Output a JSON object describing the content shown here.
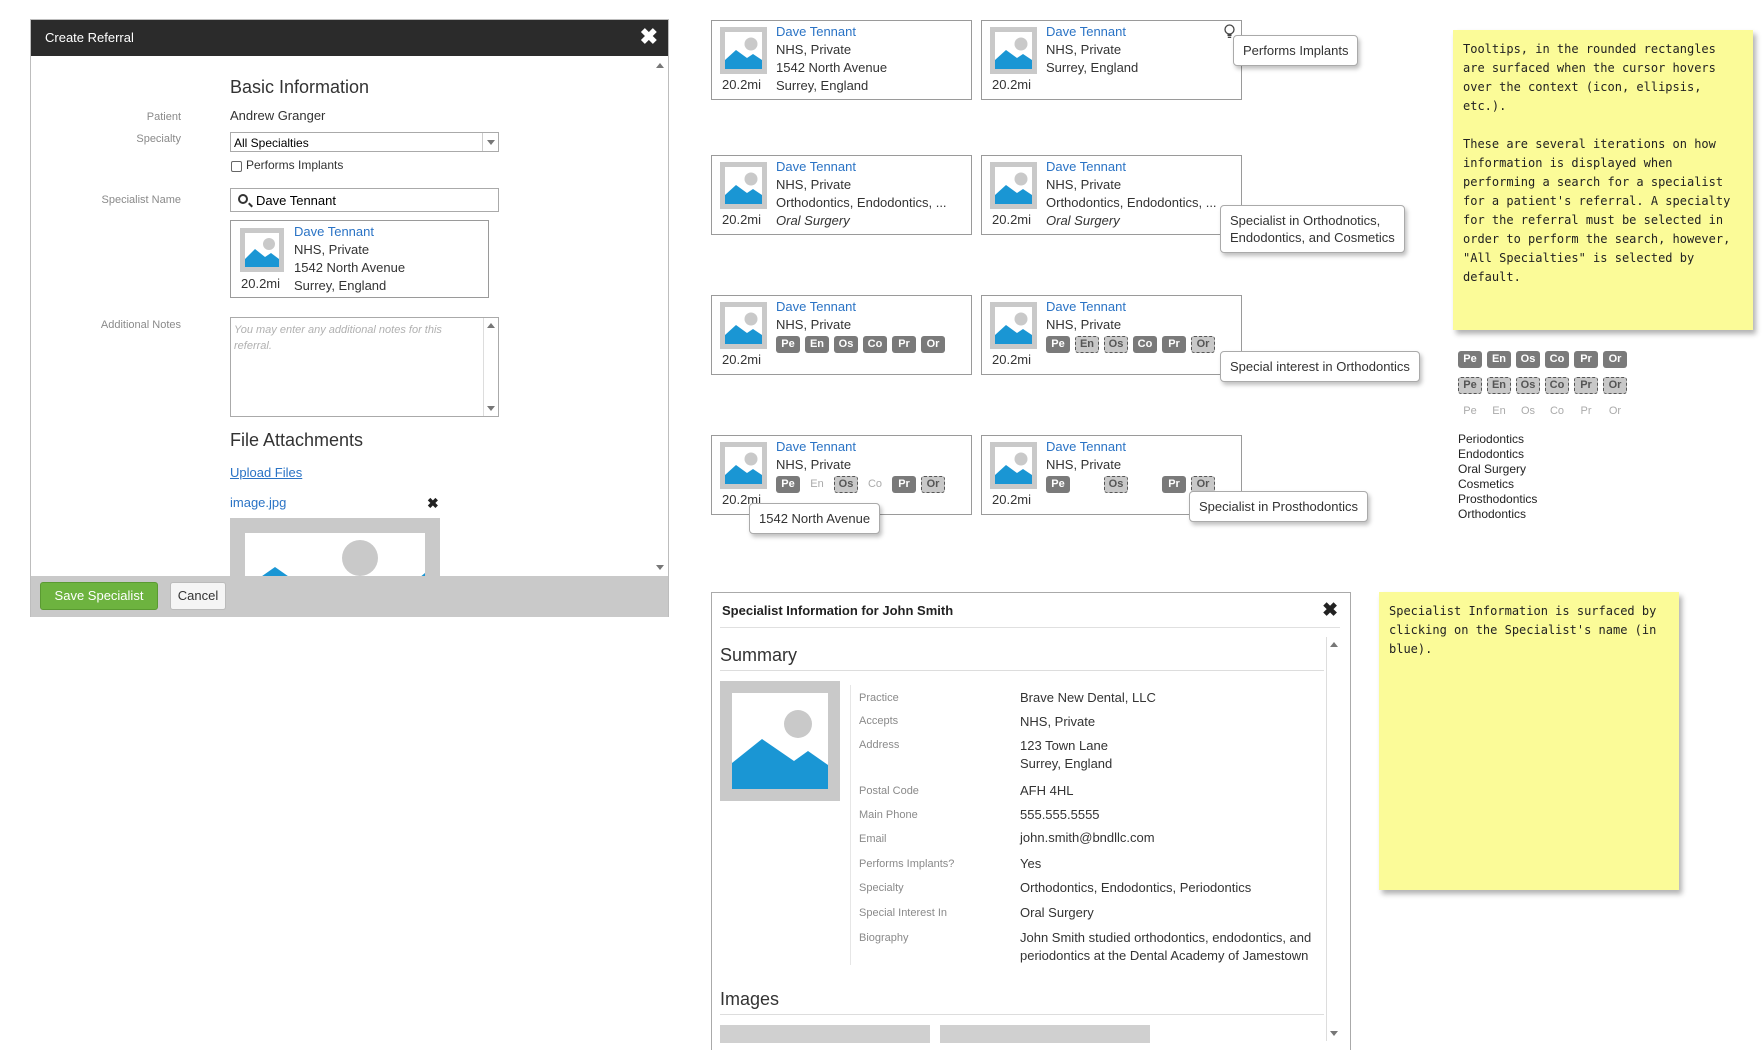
{
  "colors": {
    "link": "#2a73c5",
    "titlebar": "#2b2b2b",
    "save_button": "#6db33f",
    "sticky": "#fbfb98",
    "badge": "#7a7a7a",
    "image_blue": "#1a96d4"
  },
  "referral": {
    "title": "Create Referral",
    "close_icon": "close-icon",
    "section_basic": "Basic Information",
    "patient_label": "Patient",
    "patient_value": "Andrew Granger",
    "specialty_label": "Specialty",
    "specialty_value": "All Specialties",
    "performs_implants_label": "Performs Implants",
    "specialist_name_label": "Specialist Name",
    "specialist_search_value": "Dave Tennant",
    "result": {
      "distance": "20.2mi",
      "name": "Dave Tennant",
      "accepts": "NHS, Private",
      "address1": "1542 North Avenue",
      "address2": "Surrey, England"
    },
    "notes_label": "Additional Notes",
    "notes_placeholder": "You may enter any additional notes for this referral.",
    "section_files": "File Attachments",
    "upload_link": "Upload Files",
    "file_name": "image.jpg",
    "save_label": "Save Specialist",
    "cancel_label": "Cancel"
  },
  "cards": [
    {
      "distance": "20.2mi",
      "name": "Dave Tennant",
      "line2": "NHS, Private",
      "line3": "1542 North Avenue",
      "line4": "Surrey, England"
    },
    {
      "distance": "20.2mi",
      "name": "Dave Tennant",
      "line2": "NHS, Private",
      "line3": "Surrey, England"
    },
    {
      "distance": "20.2mi",
      "name": "Dave Tennant",
      "line2": "NHS, Private",
      "line3": "Orthodontics, Endodontics, ...",
      "line4": "Oral Surgery"
    },
    {
      "distance": "20.2mi",
      "name": "Dave Tennant",
      "line2": "NHS, Private",
      "line3": "Orthodontics, Endodontics, ...",
      "line4": "Oral Surgery"
    },
    {
      "distance": "20.2mi",
      "name": "Dave Tennant",
      "line2": "NHS, Private",
      "badges": [
        [
          "Pe",
          "solid"
        ],
        [
          "En",
          "solid"
        ],
        [
          "Os",
          "solid"
        ],
        [
          "Co",
          "solid"
        ],
        [
          "Pr",
          "solid"
        ],
        [
          "Or",
          "solid"
        ]
      ]
    },
    {
      "distance": "20.2mi",
      "name": "Dave Tennant",
      "line2": "NHS, Private",
      "badges": [
        [
          "Pe",
          "solid"
        ],
        [
          "En",
          "dash"
        ],
        [
          "Os",
          "dash"
        ],
        [
          "Co",
          "solid"
        ],
        [
          "Pr",
          "solid"
        ],
        [
          "Or",
          "dash"
        ]
      ]
    },
    {
      "distance": "20.2mi",
      "name": "Dave Tennant",
      "line2": "NHS, Private",
      "badges": [
        [
          "Pe",
          "solid"
        ],
        [
          "En",
          "faint"
        ],
        [
          "Os",
          "dash"
        ],
        [
          "Co",
          "faint"
        ],
        [
          "Pr",
          "solid"
        ],
        [
          "Or",
          "dash"
        ]
      ]
    },
    {
      "distance": "20.2mi",
      "name": "Dave Tennant",
      "line2": "NHS, Private",
      "badges": [
        [
          "Pe",
          "solid"
        ],
        [
          "En",
          "hide"
        ],
        [
          "Os",
          "dash"
        ],
        [
          "Co",
          "hide"
        ],
        [
          "Pr",
          "solid"
        ],
        [
          "Or",
          "dash"
        ]
      ]
    }
  ],
  "tooltips": {
    "implants": "Performs Implants",
    "specialist_in_line1": "Specialist in Orthodnotics,",
    "specialist_in_line2": "Endodontics, and Cosmetics",
    "special_interest": "Special interest in Orthodontics",
    "address": "1542 North Avenue",
    "prosthodontics": "Specialist in Prosthodontics"
  },
  "sticky_notes": {
    "note1_p1": "Tooltips, in the rounded rectangles are surfaced when the cursor hovers over the context (icon, ellipsis, etc.).",
    "note1_p2": "These are several iterations on how information is displayed when performing a search for a specialist for a patient's referral. A specialty for the referral must be selected in order to perform the search, however, \"All Specialties\" is selected by default.",
    "note2": "Specialist Information is surfaced by clicking on the Specialist's name (in blue)."
  },
  "legend": {
    "badges": [
      "Pe",
      "En",
      "Os",
      "Co",
      "Pr",
      "Or"
    ],
    "specialties": [
      "Periodontics",
      "Endodontics",
      "Oral Surgery",
      "Cosmetics",
      "Prosthodontics",
      "Orthodontics"
    ]
  },
  "info": {
    "title": "Specialist Information for John Smith",
    "summary": "Summary",
    "rows": [
      {
        "label": "Practice",
        "value": "Brave New Dental, LLC"
      },
      {
        "label": "Accepts",
        "value": "NHS, Private"
      },
      {
        "label": "Address",
        "value": "123 Town Lane",
        "value2": "Surrey, England"
      },
      {
        "label": "Postal Code",
        "value": "AFH 4HL"
      },
      {
        "label": "Main Phone",
        "value": "555.555.5555"
      },
      {
        "label": "Email",
        "value": "john.smith@bndllc.com"
      },
      {
        "label": "Performs Implants?",
        "value": "Yes"
      },
      {
        "label": "Specialty",
        "value": "Orthodontics, Endodontics, Periodontics"
      },
      {
        "label": "Special Interest In",
        "value": "Oral Surgery"
      },
      {
        "label": "Biography",
        "value": "John Smith studied orthodontics, endodontics, and",
        "value2": "periodontics at the Dental Academy of Jamestown"
      }
    ],
    "images": "Images"
  }
}
